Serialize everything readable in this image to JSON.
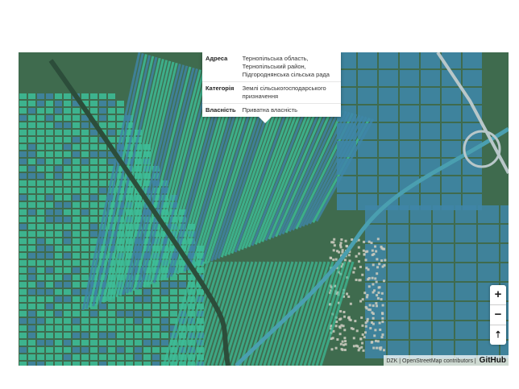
{
  "popup": {
    "rows": [
      {
        "key": "Адреса",
        "value_lines": [
          "Тернопільська область,",
          "Тернопільський район,",
          "Підгороднянська сільська рада"
        ]
      },
      {
        "key": "Категорія",
        "value_lines": [
          "Землі сільськогосподарського",
          "призначення"
        ]
      },
      {
        "key": "Власність",
        "value_lines": [
          "Приватна власність"
        ]
      }
    ]
  },
  "controls": {
    "zoom_in": "+",
    "zoom_out": "−",
    "locate": "⇡"
  },
  "attribution": {
    "text": "DZK | OpenStreetMap contributors |",
    "github": "GitHub"
  },
  "colors": {
    "parcel_private": "#3dbf9a",
    "parcel_other": "#3f86a8",
    "road": "#4a9fb0",
    "terrain": "#3f6b4e"
  }
}
